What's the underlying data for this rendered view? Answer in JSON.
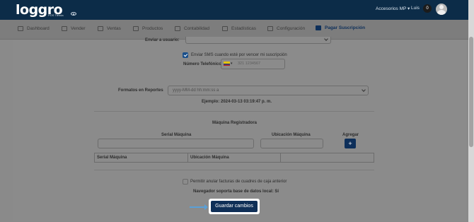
{
  "header": {
    "logo_text": "loggro",
    "logo_subtitle": "POS Tienda",
    "account_menu": "Accesorios MP ▾",
    "user_name": "Luis",
    "notification_count": "0"
  },
  "nav": {
    "items": [
      {
        "label": "Dashboard"
      },
      {
        "label": "Vender"
      },
      {
        "label": "Ventas"
      },
      {
        "label": "Productos"
      },
      {
        "label": "Contabilidad"
      },
      {
        "label": "Estadísticas"
      },
      {
        "label": "Configuración"
      },
      {
        "label": "Pagar Suscripción"
      }
    ]
  },
  "form": {
    "send_label_cut": "Enviar a usuario:",
    "sms_checkbox_label": "Enviar SMS cuando esté por vencer mi suscripción",
    "sms_checked": true,
    "phone_label": "Número Telefónico",
    "phone_country": "▾",
    "phone_placeholder": "321 1234567",
    "format_label": "Formatos en Reportes",
    "format_value": "yyyy-MM-dd hh:mm:ss a",
    "example_text": "Ejemplo: 2024-03-13 03:19:47 p. m.",
    "machines_title": "Máquina Registradora",
    "serial_label": "Serial Máquina",
    "location_label": "Ubicación Máquina",
    "add_label": "Agregar",
    "add_button": "+",
    "table_headers": [
      "Serial Máquina",
      "Ubicación Máquina",
      ""
    ],
    "cancel_checkbox_label": "Permitir anular facturas de cuadres de caja anterior",
    "cancel_checked": false,
    "local_db_text": "Navegador soporta base de datos local: Sí",
    "save_button": "Guardar cambios"
  }
}
